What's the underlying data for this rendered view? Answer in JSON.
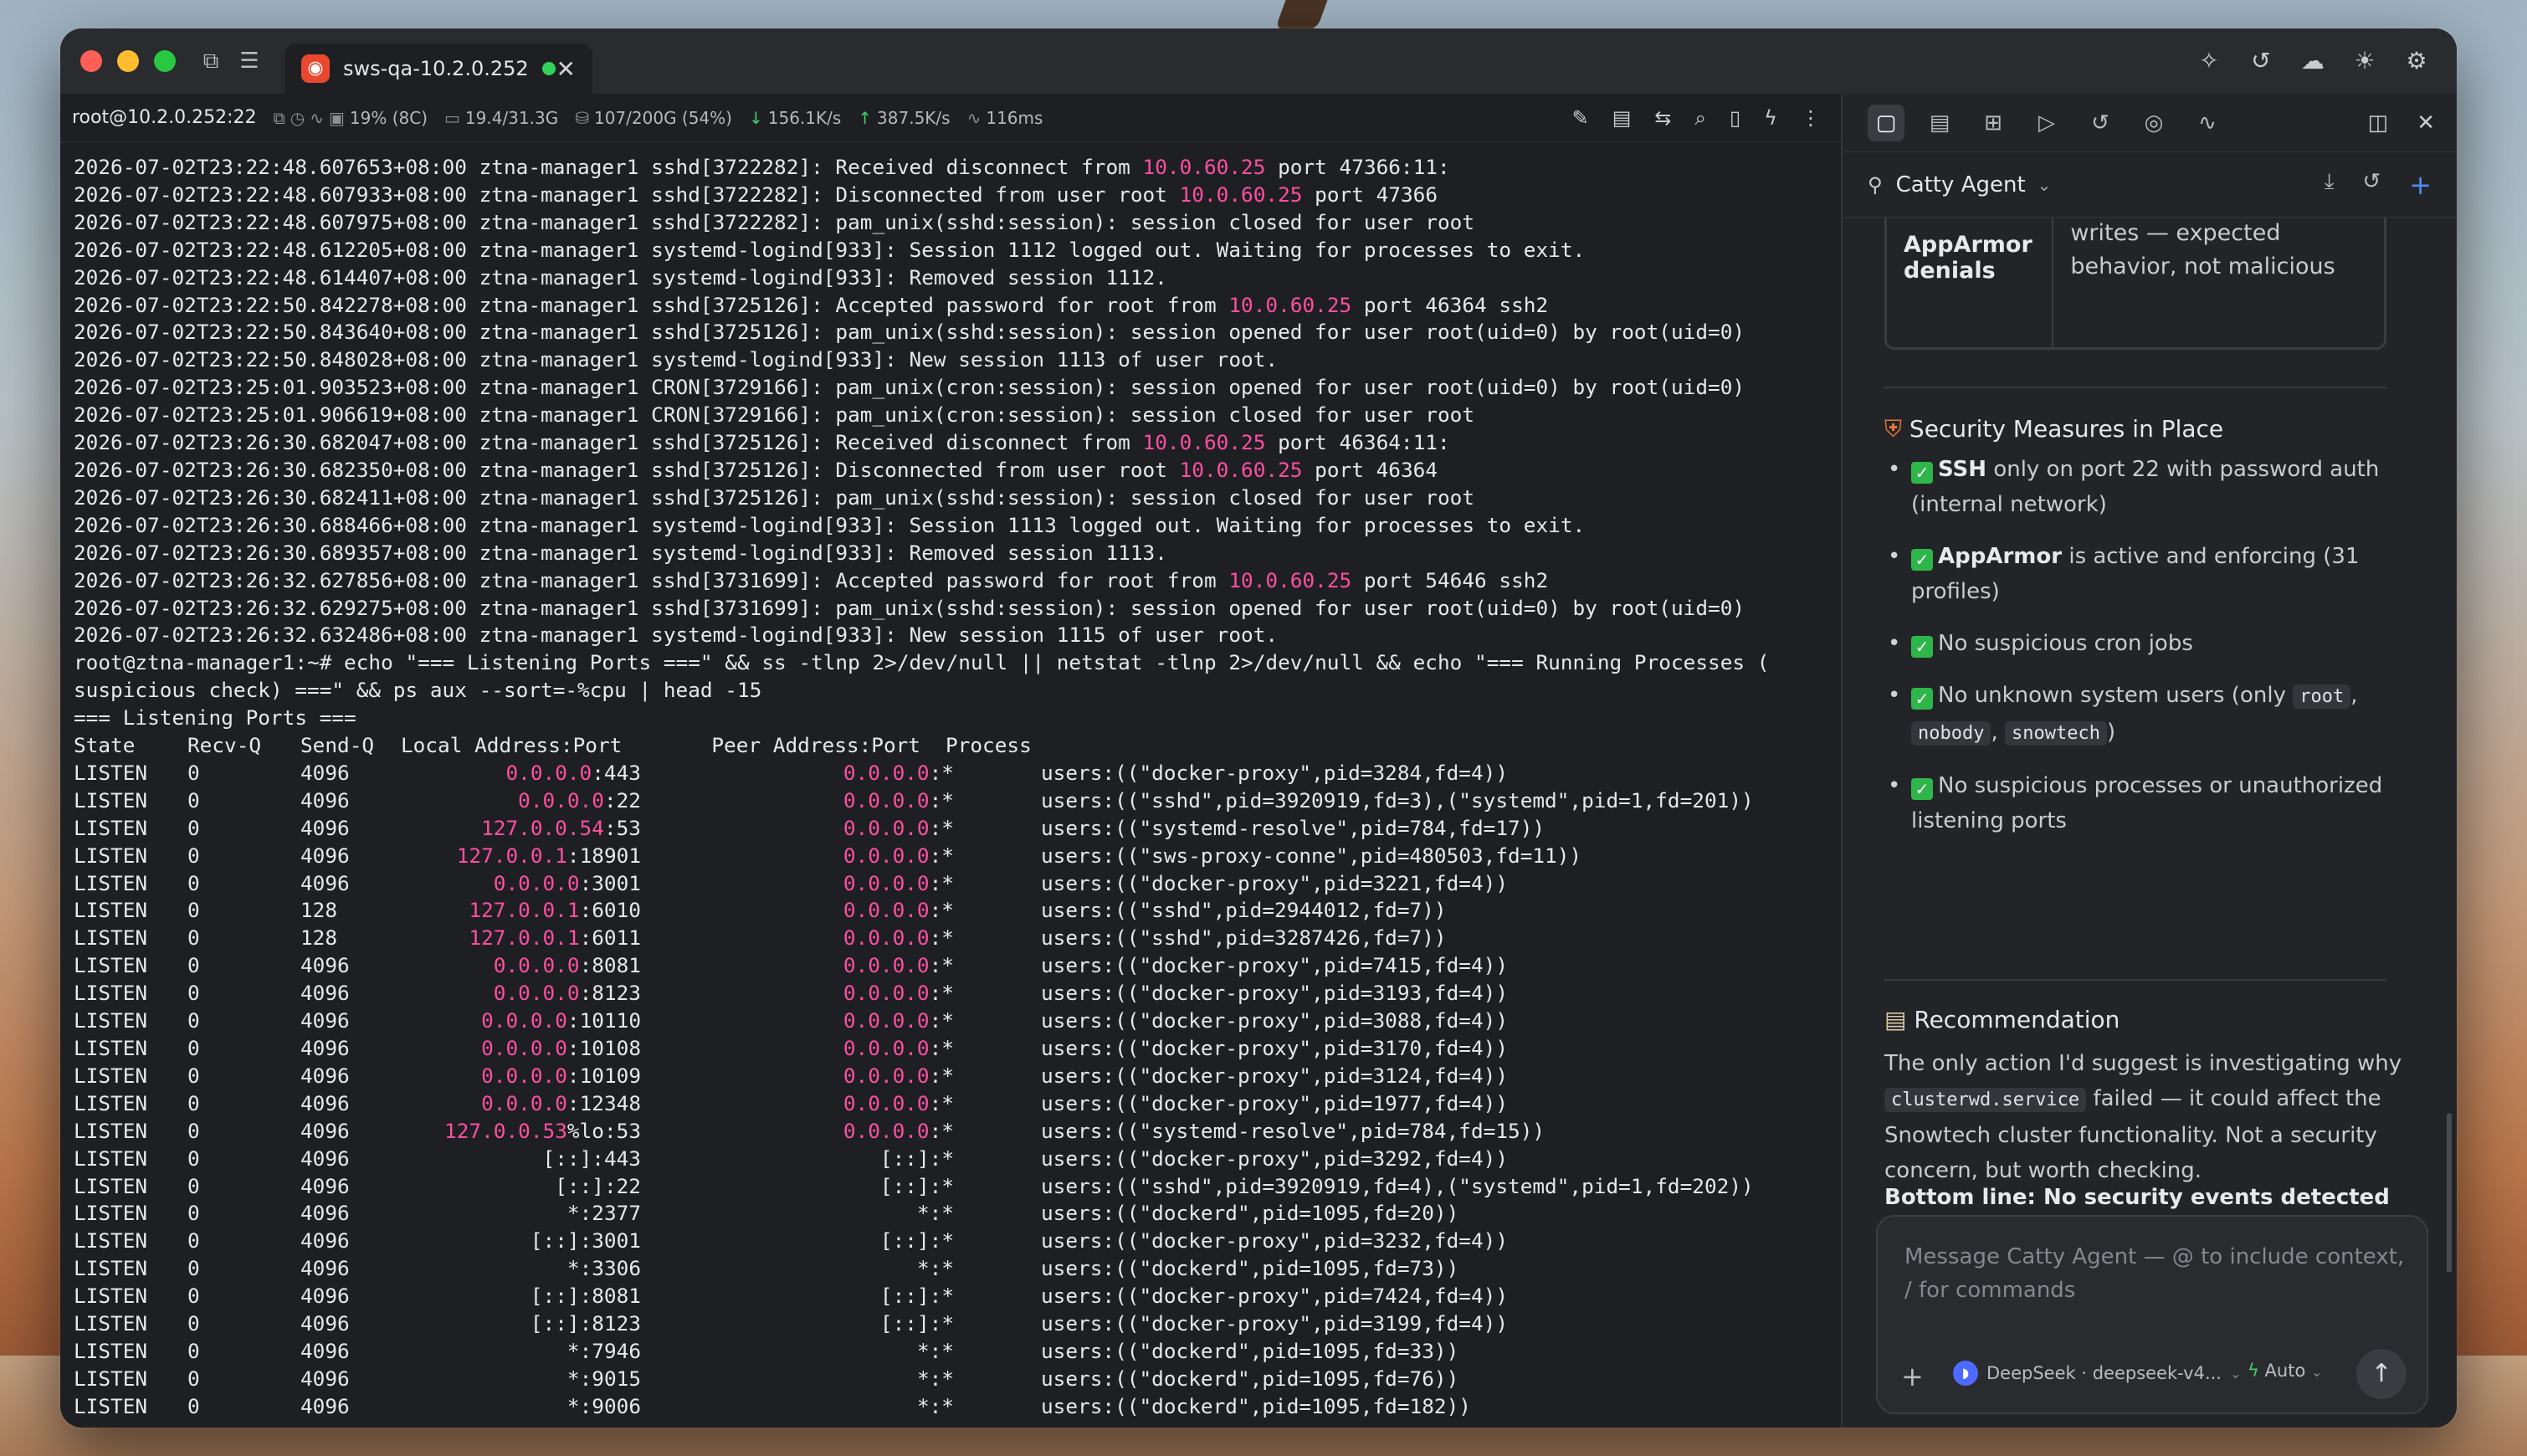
{
  "tab": {
    "title": "sws-qa-10.2.0.252"
  },
  "info": {
    "host": "root@10.2.0.252:22",
    "cpu": "19% (8C)",
    "mem": "19.4/31.3G",
    "disk": "107/200G (54%)",
    "down": "156.1K/s",
    "up": "387.5K/s",
    "latency": "116ms"
  },
  "terminal": {
    "log_lines": [
      [
        [
          "2026-07-02T23:22:48.607653+08:00 ztna-manager1 sshd[3722282]: Received disconnect from ",
          0
        ],
        [
          "10.0.60.25",
          1
        ],
        [
          " port 47366:11:",
          0
        ]
      ],
      [
        [
          "2026-07-02T23:22:48.607933+08:00 ztna-manager1 sshd[3722282]: Disconnected from user root ",
          0
        ],
        [
          "10.0.60.25",
          1
        ],
        [
          " port 47366",
          0
        ]
      ],
      [
        [
          "2026-07-02T23:22:48.607975+08:00 ztna-manager1 sshd[3722282]: pam_unix(sshd:session): session closed for user root",
          0
        ]
      ],
      [
        [
          "2026-07-02T23:22:48.612205+08:00 ztna-manager1 systemd-logind[933]: Session 1112 logged out. Waiting for processes to exit.",
          0
        ]
      ],
      [
        [
          "2026-07-02T23:22:48.614407+08:00 ztna-manager1 systemd-logind[933]: Removed session 1112.",
          0
        ]
      ],
      [
        [
          "2026-07-02T23:22:50.842278+08:00 ztna-manager1 sshd[3725126]: Accepted password for root from ",
          0
        ],
        [
          "10.0.60.25",
          1
        ],
        [
          " port 46364 ssh2",
          0
        ]
      ],
      [
        [
          "2026-07-02T23:22:50.843640+08:00 ztna-manager1 sshd[3725126]: pam_unix(sshd:session): session opened for user root(uid=0) by root(uid=0)",
          0
        ]
      ],
      [
        [
          "2026-07-02T23:22:50.848028+08:00 ztna-manager1 systemd-logind[933]: New session 1113 of user root.",
          0
        ]
      ],
      [
        [
          "2026-07-02T23:25:01.903523+08:00 ztna-manager1 CRON[3729166]: pam_unix(cron:session): session opened for user root(uid=0) by root(uid=0)",
          0
        ]
      ],
      [
        [
          "2026-07-02T23:25:01.906619+08:00 ztna-manager1 CRON[3729166]: pam_unix(cron:session): session closed for user root",
          0
        ]
      ],
      [
        [
          "2026-07-02T23:26:30.682047+08:00 ztna-manager1 sshd[3725126]: Received disconnect from ",
          0
        ],
        [
          "10.0.60.25",
          1
        ],
        [
          " port 46364:11:",
          0
        ]
      ],
      [
        [
          "2026-07-02T23:26:30.682350+08:00 ztna-manager1 sshd[3725126]: Disconnected from user root ",
          0
        ],
        [
          "10.0.60.25",
          1
        ],
        [
          " port 46364",
          0
        ]
      ],
      [
        [
          "2026-07-02T23:26:30.682411+08:00 ztna-manager1 sshd[3725126]: pam_unix(sshd:session): session closed for user root",
          0
        ]
      ],
      [
        [
          "2026-07-02T23:26:30.688466+08:00 ztna-manager1 systemd-logind[933]: Session 1113 logged out. Waiting for processes to exit.",
          0
        ]
      ],
      [
        [
          "2026-07-02T23:26:30.689357+08:00 ztna-manager1 systemd-logind[933]: Removed session 1113.",
          0
        ]
      ],
      [
        [
          "2026-07-02T23:26:32.627856+08:00 ztna-manager1 sshd[3731699]: Accepted password for root from ",
          0
        ],
        [
          "10.0.60.25",
          1
        ],
        [
          " port 54646 ssh2",
          0
        ]
      ],
      [
        [
          "2026-07-02T23:26:32.629275+08:00 ztna-manager1 sshd[3731699]: pam_unix(sshd:session): session opened for user root(uid=0) by root(uid=0)",
          0
        ]
      ],
      [
        [
          "2026-07-02T23:26:32.632486+08:00 ztna-manager1 systemd-logind[933]: New session 1115 of user root.",
          0
        ]
      ],
      [
        [
          "root@ztna-manager1:~# echo \"=== Listening Ports ===\" && ss -tlnp 2>/dev/null || netstat -tlnp 2>/dev/null && echo \"=== Running Processes (",
          0
        ]
      ],
      [
        [
          "suspicious check) ===\" && ps aux --sort=-%cpu | head -15",
          0
        ]
      ],
      [
        [
          "=== Listening Ports ===",
          0
        ]
      ]
    ],
    "ports_header": [
      "State",
      "Recv-Q",
      "Send-Q",
      "Local Address:Port",
      "Peer Address:Port",
      "Process"
    ],
    "ports": [
      [
        "LISTEN",
        "0",
        "4096",
        "0.0.0.0",
        ":443",
        "0.0.0.0",
        ":*",
        "users:((\"docker-proxy\",pid=3284,fd=4))"
      ],
      [
        "LISTEN",
        "0",
        "4096",
        "0.0.0.0",
        ":22",
        "0.0.0.0",
        ":*",
        "users:((\"sshd\",pid=3920919,fd=3),(\"systemd\",pid=1,fd=201))"
      ],
      [
        "LISTEN",
        "0",
        "4096",
        "127.0.0.54",
        ":53",
        "0.0.0.0",
        ":*",
        "users:((\"systemd-resolve\",pid=784,fd=17))"
      ],
      [
        "LISTEN",
        "0",
        "4096",
        "127.0.0.1",
        ":18901",
        "0.0.0.0",
        ":*",
        "users:((\"sws-proxy-conne\",pid=480503,fd=11))"
      ],
      [
        "LISTEN",
        "0",
        "4096",
        "0.0.0.0",
        ":3001",
        "0.0.0.0",
        ":*",
        "users:((\"docker-proxy\",pid=3221,fd=4))"
      ],
      [
        "LISTEN",
        "0",
        "128",
        "127.0.0.1",
        ":6010",
        "0.0.0.0",
        ":*",
        "users:((\"sshd\",pid=2944012,fd=7))"
      ],
      [
        "LISTEN",
        "0",
        "128",
        "127.0.0.1",
        ":6011",
        "0.0.0.0",
        ":*",
        "users:((\"sshd\",pid=3287426,fd=7))"
      ],
      [
        "LISTEN",
        "0",
        "4096",
        "0.0.0.0",
        ":8081",
        "0.0.0.0",
        ":*",
        "users:((\"docker-proxy\",pid=7415,fd=4))"
      ],
      [
        "LISTEN",
        "0",
        "4096",
        "0.0.0.0",
        ":8123",
        "0.0.0.0",
        ":*",
        "users:((\"docker-proxy\",pid=3193,fd=4))"
      ],
      [
        "LISTEN",
        "0",
        "4096",
        "0.0.0.0",
        ":10110",
        "0.0.0.0",
        ":*",
        "users:((\"docker-proxy\",pid=3088,fd=4))"
      ],
      [
        "LISTEN",
        "0",
        "4096",
        "0.0.0.0",
        ":10108",
        "0.0.0.0",
        ":*",
        "users:((\"docker-proxy\",pid=3170,fd=4))"
      ],
      [
        "LISTEN",
        "0",
        "4096",
        "0.0.0.0",
        ":10109",
        "0.0.0.0",
        ":*",
        "users:((\"docker-proxy\",pid=3124,fd=4))"
      ],
      [
        "LISTEN",
        "0",
        "4096",
        "0.0.0.0",
        ":12348",
        "0.0.0.0",
        ":*",
        "users:((\"docker-proxy\",pid=1977,fd=4))"
      ],
      [
        "LISTEN",
        "0",
        "4096",
        "127.0.0.53",
        "%lo:53",
        "0.0.0.0",
        ":*",
        "users:((\"systemd-resolve\",pid=784,fd=15))"
      ],
      [
        "LISTEN",
        "0",
        "4096",
        "",
        "[::]:443",
        "",
        "[::]:*",
        "users:((\"docker-proxy\",pid=3292,fd=4))"
      ],
      [
        "LISTEN",
        "0",
        "4096",
        "",
        "[::]:22",
        "",
        "[::]:*",
        "users:((\"sshd\",pid=3920919,fd=4),(\"systemd\",pid=1,fd=202))"
      ],
      [
        "LISTEN",
        "0",
        "4096",
        "",
        "*:2377",
        "",
        "*:*",
        "users:((\"dockerd\",pid=1095,fd=20))"
      ],
      [
        "LISTEN",
        "0",
        "4096",
        "",
        "[::]:3001",
        "",
        "[::]:*",
        "users:((\"docker-proxy\",pid=3232,fd=4))"
      ],
      [
        "LISTEN",
        "0",
        "4096",
        "",
        "*:3306",
        "",
        "*:*",
        "users:((\"dockerd\",pid=1095,fd=73))"
      ],
      [
        "LISTEN",
        "0",
        "4096",
        "",
        "[::]:8081",
        "",
        "[::]:*",
        "users:((\"docker-proxy\",pid=7424,fd=4))"
      ],
      [
        "LISTEN",
        "0",
        "4096",
        "",
        "[::]:8123",
        "",
        "[::]:*",
        "users:((\"docker-proxy\",pid=3199,fd=4))"
      ],
      [
        "LISTEN",
        "0",
        "4096",
        "",
        "*:7946",
        "",
        "*:*",
        "users:((\"dockerd\",pid=1095,fd=33))"
      ],
      [
        "LISTEN",
        "0",
        "4096",
        "",
        "*:9015",
        "",
        "*:*",
        "users:((\"dockerd\",pid=1095,fd=76))"
      ],
      [
        "LISTEN",
        "0",
        "4096",
        "",
        "*:9006",
        "",
        "*:*",
        "users:((\"dockerd\",pid=1095,fd=182))"
      ]
    ]
  },
  "agent": {
    "name": "Catty Agent",
    "table_label": "AppArmor denials",
    "table_value": "writes — expected behavior, not malicious",
    "security_heading": "Security Measures in Place",
    "rec_heading": "Recommendation",
    "rec_text_1": "The only action I'd suggest is investigating why",
    "rec_code": "clusterwd.service",
    "rec_text_2": "failed — it could affect the Snowtech cluster functionality. Not a security concern, but worth checking.",
    "bottom_line": "Bottom line: No security events detected on this server.",
    "b1_bold": "SSH",
    "b1_text": "only on port 22 with password auth (internal network)",
    "b2_bold": "AppArmor",
    "b2_text": "is active and enforcing (31 profiles)",
    "b3_text": "No suspicious cron jobs",
    "b4_text": "No unknown system users (only",
    "b4_code1": "root",
    "b4_code2": "nobody",
    "b4_code3": "snowtech",
    "b5_text": "No suspicious processes or unauthorized listening ports",
    "placeholder": "Message Catty Agent — @ to include context, / for commands",
    "model": "DeepSeek · deepseek-v4...",
    "mode": "Auto"
  },
  "colors": {
    "ip_highlight": "#ff4fa3",
    "accent": "#4f8df5",
    "ok": "#2fb64a"
  }
}
